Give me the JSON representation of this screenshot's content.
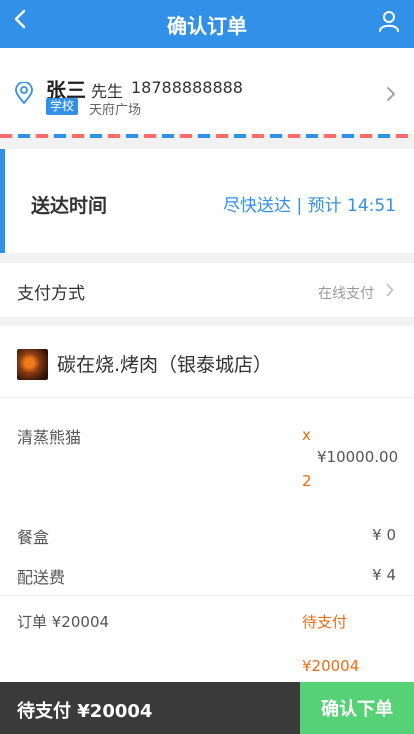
{
  "header": {
    "title": "确认订单"
  },
  "address": {
    "name": "张三",
    "gender": "先生",
    "phone": "18788888888",
    "tag": "学校",
    "street": "天府广场"
  },
  "delivery": {
    "label": "送达时间",
    "value": "尽快送达 | 预计 14:51"
  },
  "payment": {
    "label": "支付方式",
    "value": "在线支付"
  },
  "shop": {
    "name": "碳在烧.烤肉（银泰城店）"
  },
  "items": [
    {
      "name": "清蒸熊猫",
      "multiplier": "x",
      "price": "¥10000.00",
      "quantity": "2"
    }
  ],
  "box": {
    "label": "餐盒",
    "value": "¥ 0"
  },
  "fee": {
    "label": "配送费",
    "value": "¥ 4"
  },
  "order_total": {
    "label": "订单 ¥20004",
    "status": "待支付",
    "amount": "¥20004"
  },
  "bottom": {
    "due": "待支付 ¥20004",
    "confirm": "确认下单"
  },
  "colors": {
    "brand": "#3190e8",
    "accent": "#f06c15",
    "confirm": "#56d176",
    "bar": "#3a3a3a"
  },
  "icons": {
    "back": "chevron-left-icon",
    "user": "user-icon",
    "location": "location-pin-icon",
    "arrow": "chevron-right-icon"
  }
}
